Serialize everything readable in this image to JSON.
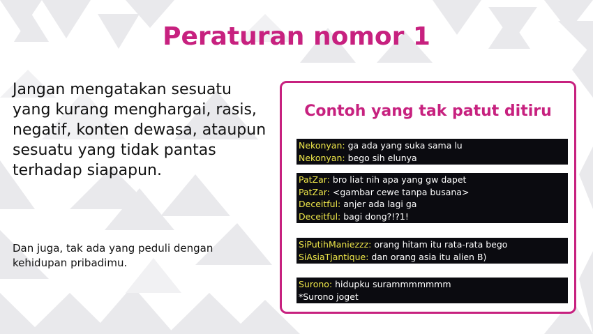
{
  "title": "Peraturan nomor 1",
  "rule_text": "Jangan mengatakan sesuatu yang kurang menghargai, rasis, negatif, konten dewasa, ataupun sesuatu yang tidak pantas terhadap siapapun.",
  "sub_text": "Dan juga, tak ada yang peduli dengan kehidupan pribadimu.",
  "panel": {
    "title": "Contoh yang tak patut ditiru",
    "chats": [
      {
        "lines": [
          {
            "nick": "Nekonyan:",
            "msg": " ga ada yang suka sama lu"
          },
          {
            "nick": "Nekonyan:",
            "msg": " bego sih elunya"
          }
        ]
      },
      {
        "lines": [
          {
            "nick": "PatZar:",
            "msg": " bro liat nih apa yang gw dapet"
          },
          {
            "nick": "PatZar:",
            "msg": " <gambar cewe tanpa busana>"
          },
          {
            "nick": "Deceitful:",
            "msg": " anjer ada lagi ga"
          },
          {
            "nick": "Deceitful:",
            "msg": " bagi dong?!?1!"
          }
        ]
      },
      {
        "lines": [
          {
            "nick": "SiPutihManiezzz:",
            "msg": " orang hitam itu rata-rata bego"
          },
          {
            "nick": "SiAsiaTjantique:",
            "msg": " dan orang asia itu alien B)"
          }
        ]
      },
      {
        "lines": [
          {
            "nick": "Surono:",
            "msg": " hidupku surammmmmmm"
          },
          {
            "nick": "",
            "msg": "*Surono joget"
          }
        ]
      }
    ]
  },
  "colors": {
    "accent": "#c7217f",
    "chat_bg": "#0b0b10",
    "nick": "#f0e84a"
  }
}
